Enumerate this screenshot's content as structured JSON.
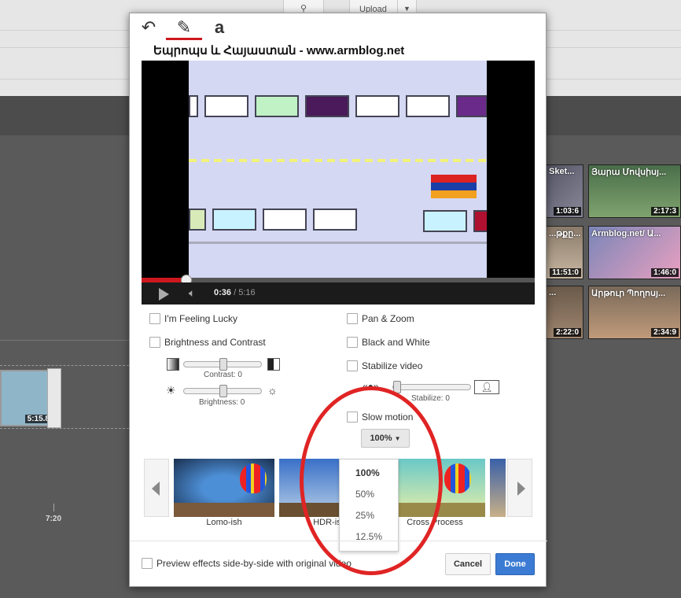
{
  "background": {
    "search_icon": "search-icon",
    "upload_label": "Upload",
    "related": [
      {
        "title": "Sket...",
        "duration": "1:03:6"
      },
      {
        "title": "Յարա Մովսիսյ...",
        "duration": "2:17:3"
      },
      {
        "title": "...թքը...",
        "duration": "11:51:0"
      },
      {
        "title": "Armblog.net/ Ա...",
        "duration": "1:46:0"
      },
      {
        "title": "...",
        "duration": "2:22:0"
      },
      {
        "title": "Արթուր Պողոսյ...",
        "duration": "2:34:9"
      }
    ],
    "timeline": {
      "clip_duration": "5:15.8",
      "marker": "7:20"
    }
  },
  "tabs": [
    {
      "icon": "undo-icon",
      "glyph": "↶"
    },
    {
      "icon": "magic-wand-icon",
      "glyph": "✎"
    },
    {
      "icon": "text-icon",
      "glyph": "a"
    }
  ],
  "video": {
    "title": "Եպրոպս և Հայաստան - www.armblog.net",
    "current_time": "0:36",
    "duration": "/ 5:16",
    "progress": 0.114
  },
  "options": {
    "lucky": "I'm Feeling Lucky",
    "brightness_contrast": "Brightness and Contrast",
    "contrast_label": "Contrast: 0",
    "brightness_label": "Brightness: 0",
    "pan_zoom": "Pan & Zoom",
    "black_white": "Black and White",
    "stabilize": "Stabilize video",
    "stabilize_label": "Stabilize: 0",
    "slow_motion": "Slow motion"
  },
  "speed": {
    "selected": "100%",
    "options": [
      "100%",
      "50%",
      "25%",
      "12.5%"
    ]
  },
  "effects": [
    {
      "label": "Lomo-ish"
    },
    {
      "label": "HDR-ish"
    },
    {
      "label": "Cross Process"
    }
  ],
  "footer": {
    "preview_label": "Preview effects side-by-side with original video",
    "cancel": "Cancel",
    "done": "Done"
  },
  "colors": {
    "accent_red": "#cc181e",
    "done_blue": "#3b7bd4",
    "annotation": "#e02424"
  }
}
